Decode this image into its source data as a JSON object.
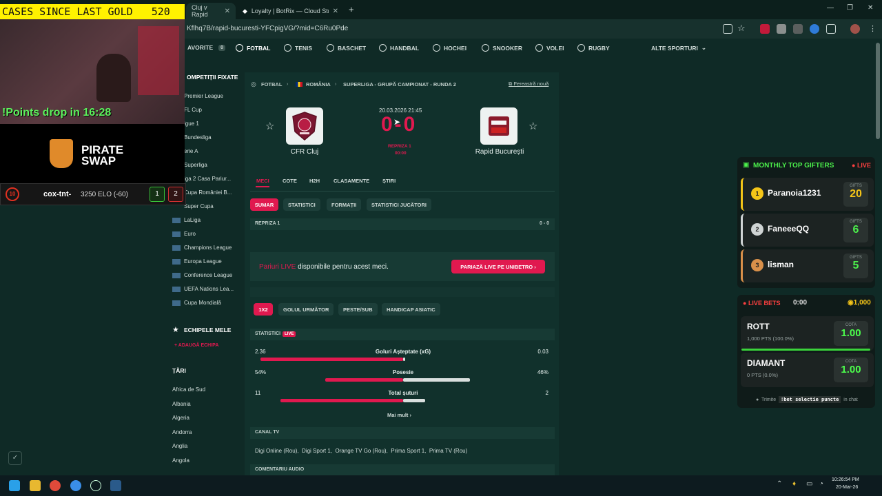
{
  "browser": {
    "tabs": [
      {
        "label": "Cluj v Rapid"
      },
      {
        "label": "Loyalty | BotRix — Cloud Strea..."
      }
    ],
    "new_tab": "+",
    "url": "Kflhq7B/rapid-bucuresti-YFCpigVG/?mid=C6Ru0Pde"
  },
  "sport_nav": {
    "favorites": "AVORITE",
    "favorites_count": "0",
    "items": [
      "FOTBAL",
      "TENIS",
      "BASCHET",
      "HANDBAL",
      "HOCHEI",
      "SNOOKER",
      "VOLEI",
      "RUGBY"
    ],
    "more": "ALTE SPORTURI"
  },
  "sidebar": {
    "pinned_heading": "OMPETIȚII FIXATE",
    "leagues": [
      "Premier League",
      "FL Cup",
      "igue 1",
      "Bundesliga",
      "erie A",
      "Superliga",
      "iga 2 Casa Pariur...",
      "Cupa României B...",
      "Super Cupa",
      "LaLiga",
      "Euro",
      "Champions League",
      "Europa League",
      "Conference League",
      "UEFA Nations Lea...",
      "Cupa Mondială"
    ],
    "my_teams_heading": "ECHIPELE MELE",
    "add_team": "ADAUGĂ ECHIPA",
    "countries_heading": "ȚĂRI",
    "countries": [
      "Africa de Sud",
      "Albania",
      "Algeria",
      "Andorra",
      "Anglia",
      "Angola"
    ]
  },
  "match": {
    "breadcrumb": [
      "FOTBAL",
      "ROMÂNIA",
      "SUPERLIGA - GRUPĂ CAMPIONAT - RUNDA 2"
    ],
    "new_window": "Fereastră nouă",
    "datetime": "20.03.2026 21:45",
    "score": "0-0",
    "period": "REPRIZA 1",
    "clock": "00:00",
    "home": "CFR Cluj",
    "away": "Rapid București",
    "tabs": [
      "MECI",
      "COTE",
      "H2H",
      "CLASAMENTE",
      "ȘTIRI"
    ],
    "subtabs": [
      "SUMAR",
      "STATISTICI",
      "FORMAȚII",
      "STATISTICI JUCĂTORI"
    ],
    "half_label": "REPRIZA 1",
    "half_score": "0 - 0",
    "live_bets_brand": "Pariuri LIVE",
    "live_bets_text": "disponibile pentru acest meci.",
    "live_bets_button": "PARIAZĂ LIVE PE UNIBETRO",
    "odds_tabs": [
      "1X2",
      "GOLUL URMĂTOR",
      "PESTE/SUB",
      "HANDICAP ASIATIC"
    ],
    "stats_heading": "STATISTICI",
    "live_badge": "LIVE",
    "stats": [
      {
        "label": "Goluri Așteptate (xG)",
        "home": "2.36",
        "away": "0.03",
        "home_frac": 0.987
      },
      {
        "label": "Posesie",
        "home": "54%",
        "away": "46%",
        "home_frac": 0.54
      },
      {
        "label": "Total șuturi",
        "home": "11",
        "away": "2",
        "home_frac": 0.846
      }
    ],
    "more": "Mai mult",
    "tv_heading": "CANAL TV",
    "tv_channels": "Digi Online (Rou),  Digi Sport 1,  Orange TV Go (Rou),  Prima Sport 1,  Prima TV (Rou)",
    "audio_heading": "COMENTARIU AUDIO"
  },
  "stream": {
    "gold_counter": "CASES SINCE LAST GOLD   520",
    "points_drop": "!Points drop in 16:28",
    "logo_line1": "PIRATE",
    "logo_line2": "SWAP",
    "player_rank": "10",
    "player_name": "cox-tnt-",
    "player_elo": "3250 ELO (-60)",
    "score_left": "1",
    "score_right": "2"
  },
  "gifters": {
    "title": "MONTHLY TOP GIFTERS",
    "live": "LIVE",
    "gifts_label": "GIFTS",
    "rows": [
      {
        "rank": "1",
        "name": "Paranoia1231",
        "gifts": "20",
        "color": "#f5c518"
      },
      {
        "rank": "2",
        "name": "FaneeeQQ",
        "gifts": "6",
        "color": "#cfd4d4"
      },
      {
        "rank": "3",
        "name": "lisman",
        "gifts": "5",
        "color": "#d9904a"
      }
    ]
  },
  "live_bets": {
    "title": "LIVE BETS",
    "timer": "0:00",
    "pool": "1,000",
    "cota_label": "COTA",
    "options": [
      {
        "name": "ROTT",
        "pts": "1,000 PTS  (100.0%)",
        "odds": "1.00"
      },
      {
        "name": "DIAMANT",
        "pts": "0 PTS  (0.0%)",
        "odds": "1.00"
      }
    ],
    "hint_pre": "Trimite",
    "hint_cmd": "!bet selectie puncte",
    "hint_post": "in chat"
  },
  "taskbar": {
    "time": "10:26:54 PM",
    "date": "20-Mar-26"
  },
  "colors": {
    "accent": "#e0194f",
    "background": "#0f2a26",
    "panel": "#11312c",
    "gold": "#fff200",
    "points_green": "#5cf25c"
  }
}
